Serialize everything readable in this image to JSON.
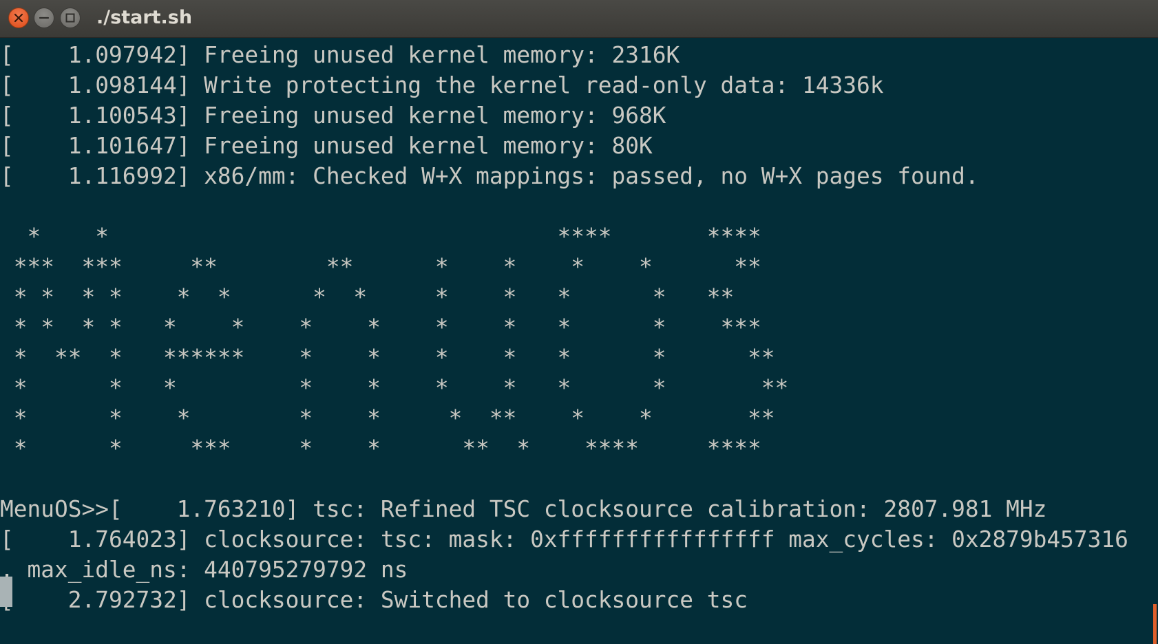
{
  "window": {
    "title": "./start.sh"
  },
  "colors": {
    "terminal_bg": "#032d38",
    "terminal_fg": "#c9c8c2",
    "titlebar_bg": "#3e3d39",
    "close_button": "#e95420",
    "scrollbar": "#e0602c"
  },
  "icons": {
    "close": "close-icon",
    "minimize": "minimize-icon",
    "maximize": "maximize-icon"
  },
  "terminal": {
    "lines": [
      "[    1.097942] Freeing unused kernel memory: 2316K",
      "[    1.098144] Write protecting the kernel read-only data: 14336k",
      "[    1.100543] Freeing unused kernel memory: 968K",
      "[    1.101647] Freeing unused kernel memory: 80K",
      "[    1.116992] x86/mm: Checked W+X mappings: passed, no W+X pages found.",
      "",
      "  *    *                                 ****       ****",
      " ***  ***     **        **      *    *    *    *      **",
      " * *  * *    *  *      *  *     *    *   *      *   **",
      " * *  * *   *    *    *    *    *    *   *      *    ***",
      " *  **  *   ******    *    *    *    *   *      *      **",
      " *      *   *         *    *    *    *   *      *       **",
      " *      *    *        *    *     *  **    *    *       **",
      " *      *     ***     *    *      **  *    ****     ****",
      "",
      "MenuOS>>[    1.763210] tsc: Refined TSC clocksource calibration: 2807.981 MHz",
      "[    1.764023] clocksource: tsc: mask: 0xffffffffffffffff max_cycles: 0x2879b457316",
      ", max_idle_ns: 440795279792 ns",
      "[    2.792732] clocksource: Switched to clocksource tsc"
    ]
  }
}
